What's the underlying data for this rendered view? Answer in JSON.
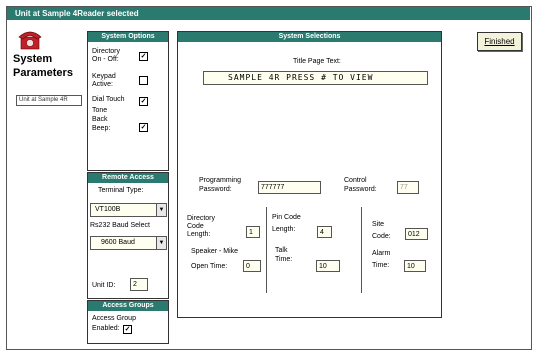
{
  "window": {
    "title": "Unit at Sample 4Reader selected"
  },
  "header": {
    "title_line1": "System",
    "title_line2": "Parameters",
    "unit_field": "Unit at Sample 4R"
  },
  "system_options": {
    "heading": "System Options",
    "directory_label_1": "Directory",
    "directory_label_2": "On - Off:",
    "directory_checked": true,
    "keypad_label_1": "Keypad",
    "keypad_label_2": "Active:",
    "keypad_checked": false,
    "dial_touch_label_1": "Dial Touch",
    "dial_touch_checked": true,
    "tone_label_1": "Tone",
    "tone_label_2": "Back",
    "tone_label_3": "Beep:",
    "tone_checked": true
  },
  "remote_access": {
    "heading": "Remote Access",
    "terminal_type_label": "Terminal Type:",
    "terminal_type_value": "VT100B",
    "baud_label": "Rs232 Baud Select",
    "baud_value": "9600 Baud",
    "unit_id_label": "Unit ID:",
    "unit_id_value": "2"
  },
  "access_groups": {
    "heading": "Access Groups",
    "label_1": "Access Group",
    "label_2": "Enabled:",
    "checked": true
  },
  "system_selections": {
    "heading": "System Selections",
    "title_page_label": "Title Page Text:",
    "title_page_value": "SAMPLE 4R PRESS # TO VIEW",
    "prog_password_label_1": "Programming",
    "prog_password_label_2": "Password:",
    "prog_password_value": "777777",
    "control_password_label_1": "Control",
    "control_password_label_2": "Password:",
    "control_password_value": "77",
    "dir_code_label_1": "Directory",
    "dir_code_label_2": "Code",
    "dir_code_label_3": "Length:",
    "dir_code_value": "1",
    "pin_code_label_1": "Pin Code",
    "pin_code_label_2": "Length:",
    "pin_code_value": "4",
    "site_code_label_1": "Site",
    "site_code_label_2": "Code:",
    "site_code_value": "012",
    "speaker_label_1": "Speaker - Mike",
    "speaker_label_2": "Open Time:",
    "speaker_value": "0",
    "talk_label_1": "Talk",
    "talk_label_2": "Time:",
    "talk_value": "10",
    "alarm_label_1": "Alarm",
    "alarm_label_2": "Time:",
    "alarm_value": "10"
  },
  "actions": {
    "finished_label": "Finished"
  },
  "colors": {
    "accent": "#2b7a70",
    "field_bg": "#fffff0",
    "check_mark": "✓"
  },
  "icons": {
    "logo": "telephone-icon",
    "dropdown": "chevron-down-icon"
  }
}
